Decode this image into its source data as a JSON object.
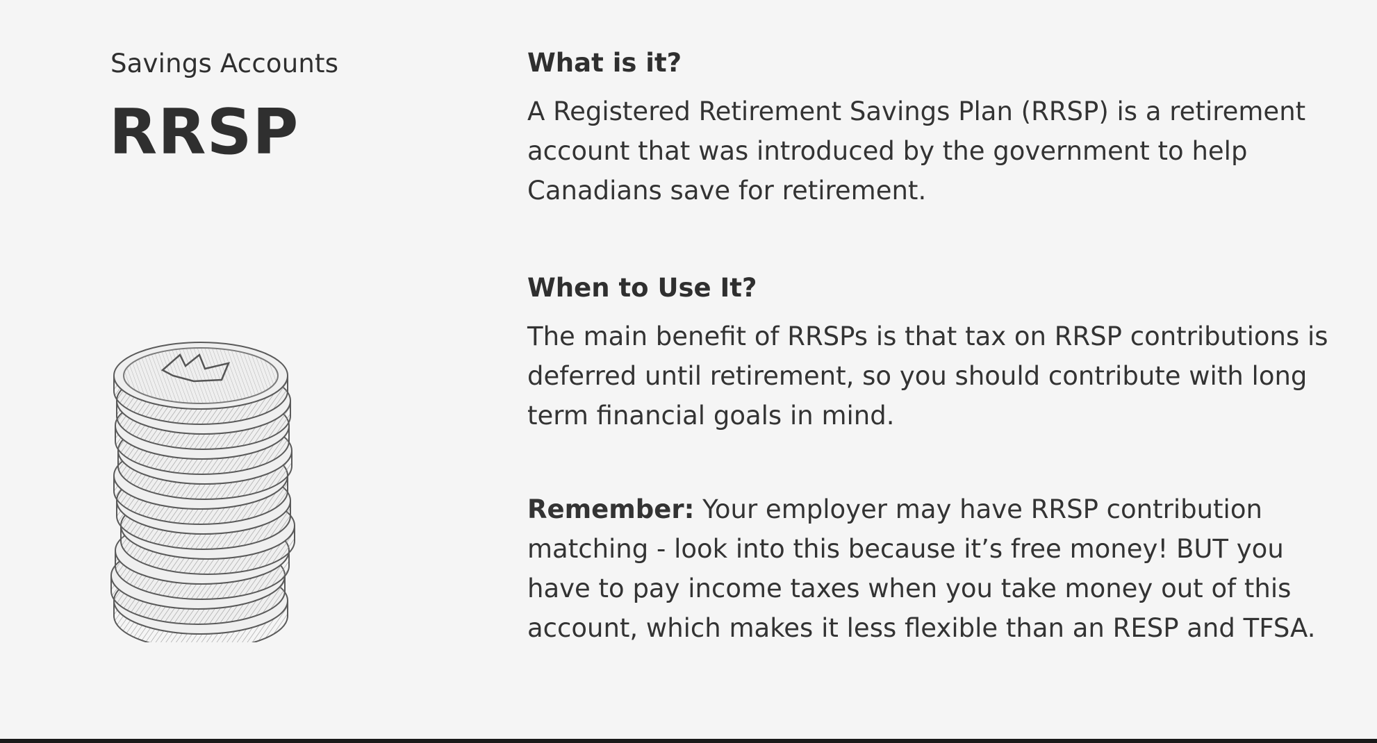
{
  "header": {
    "section_label": "Savings Accounts",
    "title": "RRSP"
  },
  "illustration": {
    "icon": "coin-stack-icon",
    "description_hidden": ""
  },
  "sections": {
    "what": {
      "heading": "What is it?",
      "lines": [
        "A Registered Retirement Savings Plan (RRSP) is a retirement",
        "account that was introduced by the government to help",
        "Canadians save for retirement."
      ]
    },
    "when": {
      "heading": "When to Use It?",
      "lines": [
        "The main benefit of RRSPs is that tax on RRSP contributions is",
        "deferred until retirement, so you should contribute with long",
        "term financial goals in mind."
      ]
    },
    "remember": {
      "label": "Remember:",
      "first_line_rest": " Your employer may have RRSP contribution",
      "lines": [
        "matching - look into this because it’s free money! BUT you",
        "have to pay income taxes when you take money out of this",
        "account, which makes it less flexible than an RESP and TFSA."
      ]
    }
  },
  "colors": {
    "background": "#f5f5f5",
    "text": "#2f2f2f",
    "rule": "#1a1a1a"
  }
}
